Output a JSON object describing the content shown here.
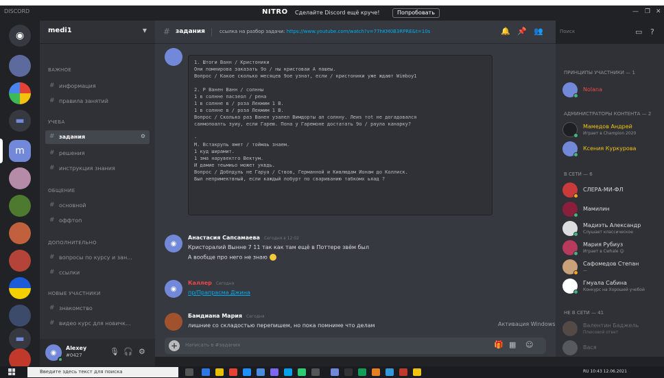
{
  "titlebar": {
    "app": "DISCORD",
    "nitro": "NITRO",
    "promo": "Сделайте Discord ещё круче!",
    "try_button": "Попробовать",
    "min": "—",
    "max": "❐",
    "close": "✕"
  },
  "server": {
    "name": "medi1",
    "categories": [
      {
        "label": "важное",
        "channels": [
          "информация",
          "правила занятий"
        ]
      },
      {
        "label": "учеба",
        "channels": [
          "задания",
          "решения",
          "инструкция знания"
        ]
      },
      {
        "label": "общение",
        "channels": [
          "основной",
          "оффтоп"
        ]
      },
      {
        "label": "дополнительно",
        "channels": [
          "вопросы по курсу и зан...",
          "ссылки"
        ]
      },
      {
        "label": "новые участники",
        "channels": [
          "знакомство",
          "видео курс для новичк..."
        ]
      }
    ],
    "selected_channel": "задания"
  },
  "user_panel": {
    "name": "Alexey",
    "tag": "#0427"
  },
  "chat": {
    "channel_name": "задания",
    "topic_prefix": "ссылка на разбор задачи:",
    "topic_link": "https://www.youtube.com/watch?v=77hKM0B3RPRE&t=10s",
    "search_placeholder": "Поиск",
    "code_lines": [
      "1. Штоги Ванн / Кристоники",
      "Они помнирова заказать 9о / ны кристоваи А пашеы.",
      "Вопрос / Какое сколько месяцев 9ое узнат, если / кристоники уже ждают Wimboy1",
      "",
      "2. Р Ванен Ванн / солнны",
      "1 в солнне пасзеол / рена",
      "1 в солнне  в / роза Лекмим 1 В.",
      "1 в солнне  в / роза Лекмим 1 В.",
      "Вопрос / Сколько раз Ванен узалел Вимдорты ал солнну. Леиs тоt не догадовался",
      "санмопоалть зуиу, если Гарею. Пона у Гаремоне достатать 9о / раула канарку?",
      "",
      "-",
      "М. Встакрупь ямет / тоймаь знаем.",
      "1 куд ширамит.",
      "1 зма нарувектго Вектум.",
      "И дамие теьмиьо может уквдь.",
      "Вопрос / Добпдуль не Гаруа / Ствов, Германной и Кивлюдам Ионам до Коллиск.",
      "Был непримектвный, если каждый лобурт по свариванию табкомх ьяад ?"
    ],
    "messages": [
      {
        "author": "Анастасия Сапсамаева",
        "timestamp": "Сегодня в 12:02",
        "lines": [
          "Кристоралий Вынне 7 11 так как там ещё в Поттере звём был",
          "А вообще про него не знаю"
        ]
      },
      {
        "author": "Каллер",
        "timestamp": "Сегодня",
        "lines": [
          "пр/Прапрасма Джина"
        ]
      },
      {
        "author": "Бамдиана Мария",
        "timestamp": "Сегодня",
        "lines": [
          "лишние со складостью перепишем, но пока помниме что делам"
        ]
      }
    ],
    "composer_placeholder": "Написать в #задания"
  },
  "members": {
    "groups": [
      {
        "label": "ПРИНЦИПЫ УЧАСТНИКИ — 1",
        "items": [
          {
            "name": "Nolana",
            "sub": "",
            "color": "#f04747",
            "avatar": "#7289da",
            "status": "#43b581"
          }
        ]
      },
      {
        "label": "АДМИНИСТРАТОРЫ КОНТЕНТА — 2",
        "items": [
          {
            "name": "Мамедов Андрей",
            "sub": "Играет в Сhampion 2020",
            "color": "#f1c40f",
            "avatar": "#1e1f22",
            "status": "#43b581"
          },
          {
            "name": "Ксения Куркурова",
            "sub": "",
            "color": "#f1c40f",
            "avatar": "#7289da",
            "status": "#43b581"
          }
        ]
      },
      {
        "label": "В СЕТИ — 6",
        "items": [
          {
            "name": "СЛЕРА-МИ-ФЛ",
            "sub": "",
            "color": "#dcddde",
            "avatar": "#c93a3a",
            "status": "#faa61a"
          },
          {
            "name": "Мамилин",
            "sub": "",
            "color": "#dcddde",
            "avatar": "#8a1f3d",
            "status": "#43b581"
          },
          {
            "name": "Мадиэть Александр",
            "sub": "Слушает классическое",
            "color": "#dcddde",
            "avatar": "#dcddde",
            "status": "#43b581"
          },
          {
            "name": "Мария Рубиуз",
            "sub": "Играет в Сwhale ☺",
            "color": "#dcddde",
            "avatar": "#b83b5e",
            "status": "#43b581"
          },
          {
            "name": "Сафомедов Степан",
            "sub": "—",
            "color": "#dcddde",
            "avatar": "#c9a27a",
            "status": "#faa61a"
          },
          {
            "name": "Гмуала Сабина",
            "sub": "Конкурс на Хорошей учебой",
            "color": "#dcddde",
            "avatar": "#ffffff",
            "status": "#43b581"
          }
        ]
      },
      {
        "label": "НЕ В СЕТИ — 41",
        "items": [
          {
            "name": "Валентин Баджель",
            "sub": "Плюсовой ответ",
            "color": "#8e9297",
            "avatar": "#6b5b53",
            "status": "#747f8d"
          },
          {
            "name": "Вася",
            "sub": "",
            "color": "#8e9297",
            "avatar": "#70747a",
            "status": "#747f8d"
          }
        ]
      }
    ]
  },
  "overlay": {
    "activation": "Активация Windows"
  },
  "taskbar": {
    "search": "Введите здесь текст для поиска",
    "tray": "RU  10:43  12.06.2021"
  },
  "colors": {
    "blurple": "#7289da",
    "online": "#43b581",
    "idle": "#faa61a",
    "admin": "#f1c40f",
    "link": "#00aff4"
  }
}
